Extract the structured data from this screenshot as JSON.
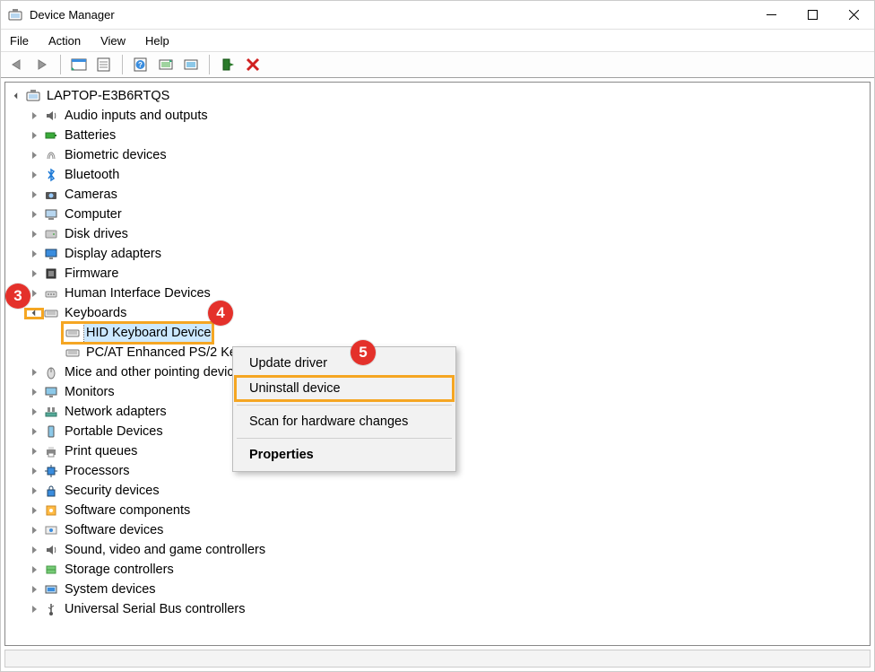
{
  "window": {
    "title": "Device Manager"
  },
  "menu": {
    "file": "File",
    "action": "Action",
    "view": "View",
    "help": "Help"
  },
  "root": {
    "name": "LAPTOP-E3B6RTQS"
  },
  "categories": [
    {
      "key": "audio",
      "label": "Audio inputs and outputs",
      "icon": "speaker"
    },
    {
      "key": "batt",
      "label": "Batteries",
      "icon": "battery"
    },
    {
      "key": "bio",
      "label": "Biometric devices",
      "icon": "fingerprint"
    },
    {
      "key": "bt",
      "label": "Bluetooth",
      "icon": "bluetooth"
    },
    {
      "key": "cam",
      "label": "Cameras",
      "icon": "camera"
    },
    {
      "key": "comp",
      "label": "Computer",
      "icon": "computer"
    },
    {
      "key": "disk",
      "label": "Disk drives",
      "icon": "disk"
    },
    {
      "key": "disp",
      "label": "Display adapters",
      "icon": "display"
    },
    {
      "key": "fw",
      "label": "Firmware",
      "icon": "chip"
    },
    {
      "key": "hid",
      "label": "Human Interface Devices",
      "icon": "hid"
    },
    {
      "key": "kb",
      "label": "Keyboards",
      "icon": "keyboard",
      "expanded": true
    },
    {
      "key": "mice",
      "label": "Mice and other pointing devices",
      "icon": "mouse"
    },
    {
      "key": "mon",
      "label": "Monitors",
      "icon": "monitor"
    },
    {
      "key": "net",
      "label": "Network adapters",
      "icon": "network"
    },
    {
      "key": "port",
      "label": "Portable Devices",
      "icon": "portable"
    },
    {
      "key": "prque",
      "label": "Print queues",
      "icon": "printer"
    },
    {
      "key": "proc",
      "label": "Processors",
      "icon": "cpu"
    },
    {
      "key": "sec",
      "label": "Security devices",
      "icon": "security"
    },
    {
      "key": "swc",
      "label": "Software components",
      "icon": "swcomp"
    },
    {
      "key": "swd",
      "label": "Software devices",
      "icon": "swdev"
    },
    {
      "key": "snd",
      "label": "Sound, video and game controllers",
      "icon": "sound"
    },
    {
      "key": "stor",
      "label": "Storage controllers",
      "icon": "storage"
    },
    {
      "key": "sys",
      "label": "System devices",
      "icon": "system"
    },
    {
      "key": "usb",
      "label": "Universal Serial Bus controllers",
      "icon": "usb"
    }
  ],
  "keyboards_children": [
    {
      "label": "HID Keyboard Device",
      "selected": true,
      "highlight": true
    },
    {
      "label": "PC/AT Enhanced PS/2 Keyboard (101/102-Key)"
    }
  ],
  "context_menu": {
    "update": "Update driver",
    "uninstall": "Uninstall device",
    "scan": "Scan for hardware changes",
    "properties": "Properties"
  },
  "annotations": {
    "a3": "3",
    "a4": "4",
    "a5": "5"
  }
}
